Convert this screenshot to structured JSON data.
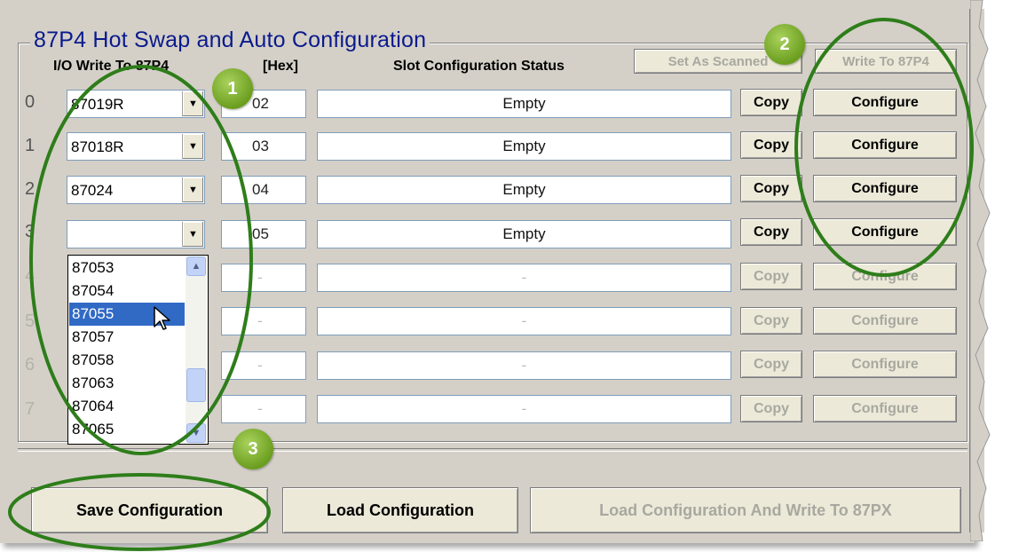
{
  "group_title": "87P4 Hot Swap and Auto Configuration",
  "headers": {
    "io": "I/O Write To 87P4",
    "addr": "[Hex]",
    "status": "Slot Configuration Status"
  },
  "top_buttons": {
    "set_as_scanned": "Set As Scanned",
    "write_to": "Write To 87P4"
  },
  "rows": [
    {
      "index": "0",
      "module": "87019R",
      "addr": "02",
      "status": "Empty",
      "copy": "Copy",
      "configure": "Configure",
      "enabled": true
    },
    {
      "index": "1",
      "module": "87018R",
      "addr": "03",
      "status": "Empty",
      "copy": "Copy",
      "configure": "Configure",
      "enabled": true
    },
    {
      "index": "2",
      "module": "87024",
      "addr": "04",
      "status": "Empty",
      "copy": "Copy",
      "configure": "Configure",
      "enabled": true
    },
    {
      "index": "3",
      "module": "",
      "addr": "05",
      "status": "Empty",
      "copy": "Copy",
      "configure": "Configure",
      "enabled": true
    },
    {
      "index": "4",
      "module": "",
      "addr": "-",
      "status": "-",
      "copy": "Copy",
      "configure": "Configure",
      "enabled": false
    },
    {
      "index": "5",
      "module": "",
      "addr": "-",
      "status": "-",
      "copy": "Copy",
      "configure": "Configure",
      "enabled": false
    },
    {
      "index": "6",
      "module": "",
      "addr": "-",
      "status": "-",
      "copy": "Copy",
      "configure": "Configure",
      "enabled": false
    },
    {
      "index": "7",
      "module": "",
      "addr": "-",
      "status": "-",
      "copy": "Copy",
      "configure": "Configure",
      "enabled": false
    }
  ],
  "dropdown_items": [
    "87053",
    "87054",
    "87055",
    "87057",
    "87058",
    "87063",
    "87064",
    "87065"
  ],
  "dropdown_selected": "87055",
  "bottom_buttons": {
    "save": "Save Configuration",
    "load": "Load Configuration",
    "load_write": "Load  Configuration And Write To 87PX"
  },
  "badges": [
    "1",
    "2",
    "3"
  ],
  "colors": {
    "window_bg": "#d4d0c8",
    "title_blue": "#0a1a8c",
    "highlight_oval": "#2e7d1a",
    "selection": "#316ac5"
  },
  "icons": {
    "combo_arrow": "chevron-down-icon",
    "scroll_up": "chevron-up-icon",
    "scroll_down": "chevron-down-icon",
    "cursor": "mouse-pointer-icon"
  }
}
